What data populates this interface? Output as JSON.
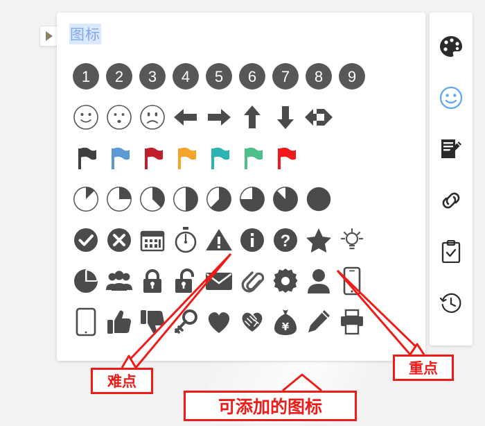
{
  "window": {
    "background_color": "#f2f2f2",
    "panel_background": "#ffffff"
  },
  "expand_button": {
    "icon": "play-triangle-icon",
    "label": ""
  },
  "panel": {
    "title": "图标",
    "title_color": "#7fa9ee",
    "rows": [
      {
        "name": "numbered-circles",
        "icons": [
          {
            "name": "number-1-icon",
            "label": "1"
          },
          {
            "name": "number-2-icon",
            "label": "2"
          },
          {
            "name": "number-3-icon",
            "label": "3"
          },
          {
            "name": "number-4-icon",
            "label": "4"
          },
          {
            "name": "number-5-icon",
            "label": "5"
          },
          {
            "name": "number-6-icon",
            "label": "6"
          },
          {
            "name": "number-7-icon",
            "label": "7"
          },
          {
            "name": "number-8-icon",
            "label": "8"
          },
          {
            "name": "number-9-icon",
            "label": "9"
          }
        ]
      },
      {
        "name": "faces-and-arrows",
        "icons": [
          {
            "name": "face-smile-icon",
            "label": ""
          },
          {
            "name": "face-neutral-icon",
            "label": ""
          },
          {
            "name": "face-sad-icon",
            "label": ""
          },
          {
            "name": "arrow-left-icon",
            "label": ""
          },
          {
            "name": "arrow-right-icon",
            "label": ""
          },
          {
            "name": "arrow-up-icon",
            "label": ""
          },
          {
            "name": "arrow-down-icon",
            "label": ""
          },
          {
            "name": "arrow-left-right-icon",
            "label": ""
          }
        ]
      },
      {
        "name": "flags",
        "icons": [
          {
            "name": "flag-dark-icon",
            "label": "",
            "color": "#3f3f3f"
          },
          {
            "name": "flag-blue-icon",
            "label": "",
            "color": "#5b9bd5"
          },
          {
            "name": "flag-darkred-icon",
            "label": "",
            "color": "#c0202a"
          },
          {
            "name": "flag-orange-icon",
            "label": "",
            "color": "#f5a42a"
          },
          {
            "name": "flag-teal-icon",
            "label": "",
            "color": "#2cb3b3"
          },
          {
            "name": "flag-green-icon",
            "label": "",
            "color": "#4cbf8b"
          },
          {
            "name": "flag-red-icon",
            "label": "",
            "color": "#f01a1a"
          }
        ]
      },
      {
        "name": "pie-progress",
        "icons": [
          {
            "name": "pie-12-percent-icon",
            "label": "",
            "value": 12.5
          },
          {
            "name": "pie-25-percent-icon",
            "label": "",
            "value": 25
          },
          {
            "name": "pie-37-percent-icon",
            "label": "",
            "value": 37.5
          },
          {
            "name": "pie-50-percent-icon",
            "label": "",
            "value": 50
          },
          {
            "name": "pie-62-percent-icon",
            "label": "",
            "value": 62.5
          },
          {
            "name": "pie-75-percent-icon",
            "label": "",
            "value": 75
          },
          {
            "name": "pie-87-percent-icon",
            "label": "",
            "value": 87.5
          },
          {
            "name": "pie-100-percent-icon",
            "label": "",
            "value": 100
          }
        ]
      },
      {
        "name": "status-symbols",
        "icons": [
          {
            "name": "check-circle-icon",
            "label": ""
          },
          {
            "name": "cross-circle-icon",
            "label": ""
          },
          {
            "name": "calendar-icon",
            "label": ""
          },
          {
            "name": "stopwatch-icon",
            "label": ""
          },
          {
            "name": "warning-triangle-icon",
            "label": ""
          },
          {
            "name": "info-circle-icon",
            "label": ""
          },
          {
            "name": "question-circle-icon",
            "label": ""
          },
          {
            "name": "star-icon",
            "label": ""
          },
          {
            "name": "lightbulb-icon",
            "label": ""
          }
        ]
      },
      {
        "name": "objects-row-one",
        "icons": [
          {
            "name": "pie-chart-icon",
            "label": ""
          },
          {
            "name": "people-group-icon",
            "label": ""
          },
          {
            "name": "lock-closed-icon",
            "label": ""
          },
          {
            "name": "lock-open-icon",
            "label": ""
          },
          {
            "name": "envelope-icon",
            "label": ""
          },
          {
            "name": "paperclip-icon",
            "label": ""
          },
          {
            "name": "gear-icon",
            "label": ""
          },
          {
            "name": "person-icon",
            "label": ""
          },
          {
            "name": "mobile-phone-icon",
            "label": ""
          }
        ]
      },
      {
        "name": "objects-row-two",
        "icons": [
          {
            "name": "tablet-icon",
            "label": ""
          },
          {
            "name": "thumbs-up-icon",
            "label": ""
          },
          {
            "name": "thumbs-down-icon",
            "label": ""
          },
          {
            "name": "key-icon",
            "label": ""
          },
          {
            "name": "heart-icon",
            "label": ""
          },
          {
            "name": "handshake-icon",
            "label": ""
          },
          {
            "name": "money-bag-icon",
            "label": "¥"
          },
          {
            "name": "pencil-icon",
            "label": ""
          },
          {
            "name": "printer-icon",
            "label": ""
          }
        ]
      }
    ]
  },
  "sidebar": {
    "items": [
      {
        "name": "palette-icon",
        "label": "",
        "active": false
      },
      {
        "name": "smiley-icon",
        "label": "",
        "active": true
      },
      {
        "name": "notes-edit-icon",
        "label": "",
        "active": false
      },
      {
        "name": "link-chain-icon",
        "label": "",
        "active": false
      },
      {
        "name": "clipboard-check-icon",
        "label": "",
        "active": false
      },
      {
        "name": "history-clock-icon",
        "label": "",
        "active": false
      }
    ],
    "active_color": "#5fa8f5"
  },
  "annotations": {
    "color": "#ee1c18",
    "nandian": "难点",
    "ketianjia": "可添加的图标",
    "zhongdian": "重点"
  }
}
